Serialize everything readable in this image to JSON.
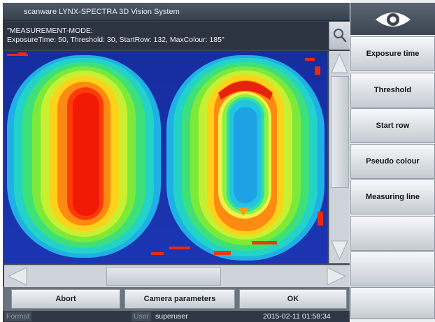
{
  "window": {
    "title": "scanware LYNX-SPECTRA 3D Vision System",
    "status_message": "\"MEASUREMENT-MODE:\nExposureTime: 50, Threshold: 30, StartRow: 132, MaxColour: 185\""
  },
  "actions": {
    "abort": "Abort",
    "camera_parameters": "Camera parameters",
    "ok": "OK"
  },
  "statusbar": {
    "format_label": "Format",
    "format_value": "",
    "user_label": "User",
    "user_value": "superuser",
    "datetime": "2015-02-11 01:58:34"
  },
  "sidebar": {
    "items": [
      {
        "label": "Exposure time"
      },
      {
        "label": "Threshold"
      },
      {
        "label": "Start row"
      },
      {
        "label": "Pseudo colour"
      },
      {
        "label": "Measuring line"
      },
      {
        "label": ""
      },
      {
        "label": ""
      },
      {
        "label": ""
      }
    ]
  },
  "icons": {
    "eye": "eye-icon",
    "search": "magnifier-icon",
    "scroll_up": "triangle-up-icon",
    "scroll_down": "triangle-down-icon",
    "scroll_left": "triangle-left-icon",
    "scroll_right": "triangle-right-icon"
  },
  "colors": {
    "accent": "#3b4552",
    "heatmap_low": "#1c2fa8",
    "heatmap_high": "#ff1a00"
  }
}
